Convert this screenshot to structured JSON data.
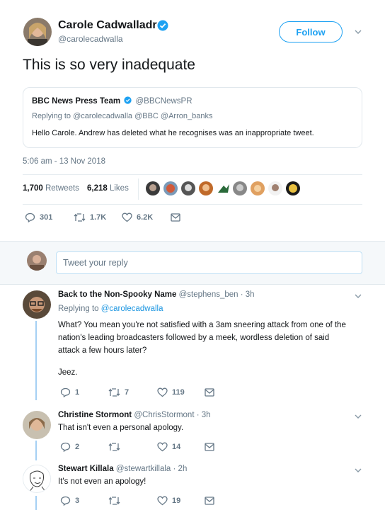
{
  "main_tweet": {
    "author_name": "Carole Cadwalladr",
    "handle": "@carolecadwalla",
    "follow_label": "Follow",
    "text": "This is so very inadequate",
    "timestamp": "5:06 am - 13 Nov 2018",
    "retweets_count": "1,700",
    "retweets_label": "Retweets",
    "likes_count": "6,218",
    "likes_label": "Likes",
    "actions": {
      "replies": "301",
      "retweets": "1.7K",
      "likes": "6.2K"
    }
  },
  "quoted_tweet": {
    "author_name": "BBC News Press Team",
    "handle": "@BBCNewsPR",
    "replying_to": "Replying to @carolecadwalla @BBC @Arron_banks",
    "text": "Hello Carole. Andrew has deleted what he recognises was an inappropriate tweet."
  },
  "reply_box": {
    "placeholder": "Tweet your reply"
  },
  "replies": [
    {
      "author_name": "Back to the Non-Spooky Name",
      "meta": "@stephens_ben · 3h",
      "replying_prefix": "Replying to ",
      "replying_handle": "@carolecadwalla",
      "text_lines": [
        "What? You mean you're not satisfied with a 3am sneering attack from one of the",
        "nation's leading broadcasters followed by a meek, wordless deletion of said",
        "attack a few hours later?"
      ],
      "text_extra": "Jeez.",
      "actions": {
        "replies": "1",
        "retweets": "7",
        "likes": "119"
      }
    },
    {
      "author_name": "Christine Stormont",
      "meta": "@ChrisStormont · 3h",
      "text": "That isn't even a personal apology.",
      "actions": {
        "replies": "2",
        "retweets": "",
        "likes": "14"
      }
    },
    {
      "author_name": "Stewart Killala",
      "meta": "@stewartkillala · 2h",
      "text": "It's not even an apology!",
      "actions": {
        "replies": "3",
        "retweets": "",
        "likes": "19"
      }
    }
  ],
  "colors": {
    "accent": "#1da1f2",
    "verified": "#1da1f2",
    "muted": "#657786",
    "link": "#1b95e0"
  }
}
